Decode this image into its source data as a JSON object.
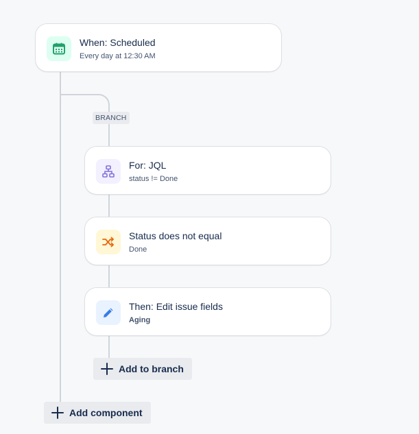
{
  "trigger": {
    "title": "When: Scheduled",
    "subtitle": "Every day at 12:30 AM",
    "icon": "calendar-icon",
    "accent": "#22a06b"
  },
  "branch": {
    "tag": "BRANCH",
    "for_card": {
      "title": "For: JQL",
      "subtitle": "status != Done",
      "icon": "hierarchy-icon",
      "accent": "#8270db"
    },
    "condition_card": {
      "title": "Status does not equal",
      "subtitle": "Done",
      "icon": "shuffle-icon",
      "accent": "#e56910"
    },
    "action_card": {
      "title": "Then: Edit issue fields",
      "subtitle": "Aging",
      "icon": "pencil-icon",
      "accent": "#357de8"
    },
    "add_to_branch_label": "Add to branch"
  },
  "add_component_label": "Add component"
}
